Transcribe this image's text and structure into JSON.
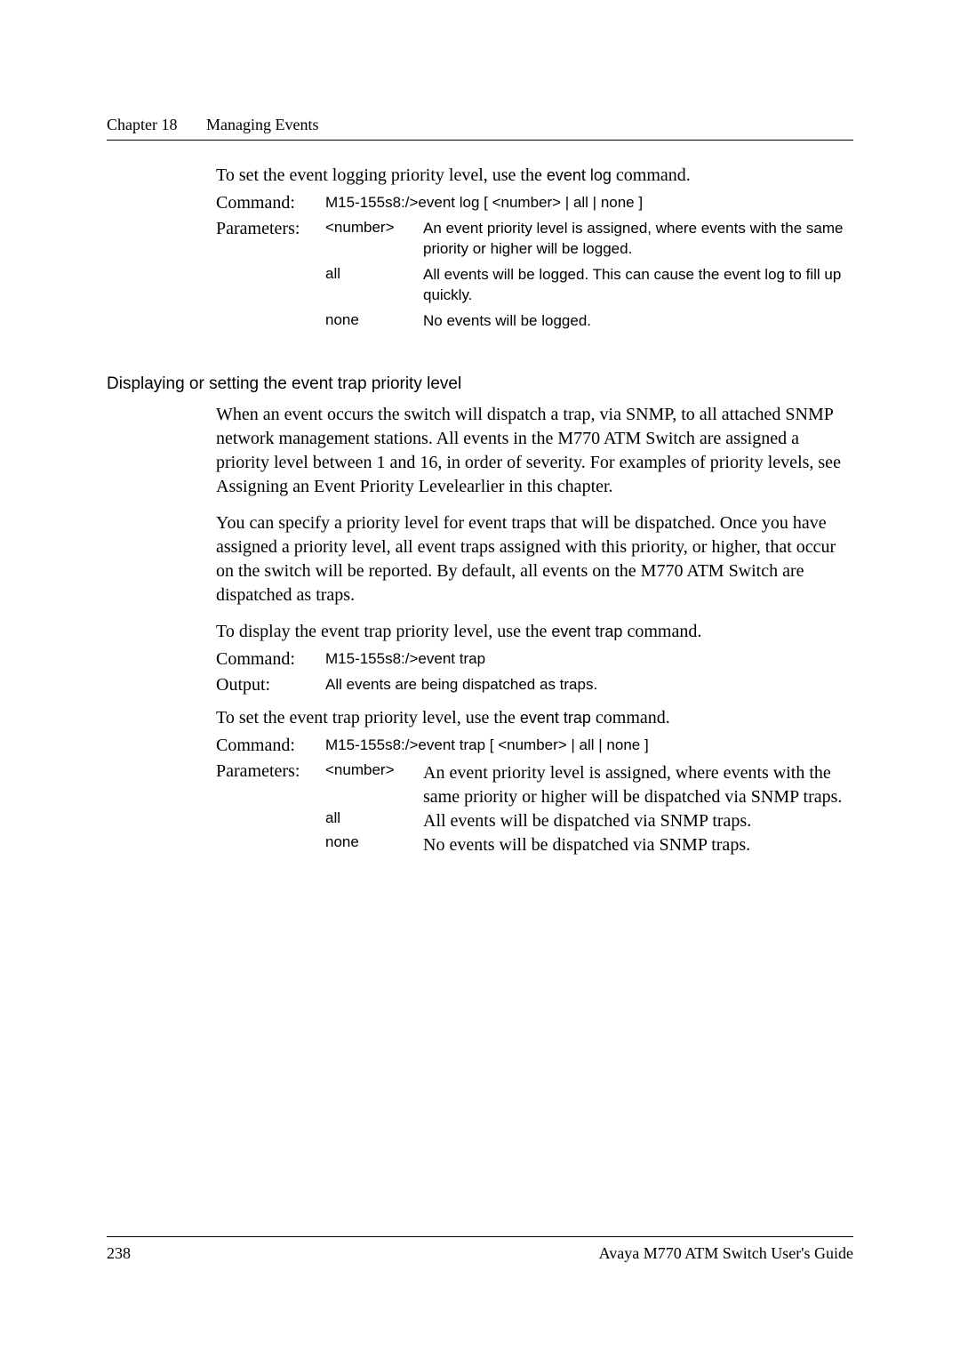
{
  "header": {
    "chapter_label": "Chapter 18",
    "chapter_title": "Managing Events"
  },
  "intro1": {
    "pre": "To set the event logging priority level, use the ",
    "cmd": "event log",
    "post": " command."
  },
  "block1": {
    "command_label": "Command:",
    "command_value": "M15-155s8:/>event log [ <number> | all | none ]",
    "param_label": "Parameters:",
    "rows": [
      {
        "key": "<number>",
        "desc": "An event priority level is assigned, where events with the same priority or higher will be logged."
      },
      {
        "key": "all",
        "desc": "All events will be logged. This can cause the event log to fill up quickly."
      },
      {
        "key": "none",
        "desc": "No events will be logged."
      }
    ]
  },
  "section_heading": "Displaying or setting the event trap priority level",
  "para1": "When an event occurs the switch will dispatch a trap, via SNMP, to all attached SNMP network management stations. All events in the M770 ATM Switch are assigned a priority level between 1 and 16, in order of severity. For examples of priority levels, see Assigning an Event Priority Levelearlier in this chapter.",
  "para2": "You can specify a priority level for event traps that will be dispatched. Once you have assigned a priority level, all event traps assigned with this priority, or higher, that occur on the switch will be reported. By default, all events on the M770 ATM Switch are dispatched as traps.",
  "intro2": {
    "pre": "To display the event trap priority level, use the ",
    "cmd": "event trap",
    "post": " command."
  },
  "block2": {
    "command_label": "Command:",
    "command_value": "M15-155s8:/>event trap",
    "output_label": "Output:",
    "output_value": "All events are being dispatched as traps."
  },
  "intro3": {
    "pre": "To set the event trap priority level, use the ",
    "cmd": "event trap",
    "post": " command."
  },
  "block3": {
    "command_label": "Command:",
    "command_value": "M15-155s8:/>event trap [ <number> | all | none ]",
    "param_label": "Parameters:",
    "rows": [
      {
        "key": "<number>",
        "desc": "An event priority level is assigned, where events with the same priority or higher will be dispatched via SNMP traps."
      },
      {
        "key": "all",
        "desc": "All events will be dispatched via SNMP traps."
      },
      {
        "key": "none",
        "desc": "No events will be dispatched via SNMP traps."
      }
    ]
  },
  "footer": {
    "page": "238",
    "title": "Avaya M770 ATM Switch User's Guide"
  }
}
